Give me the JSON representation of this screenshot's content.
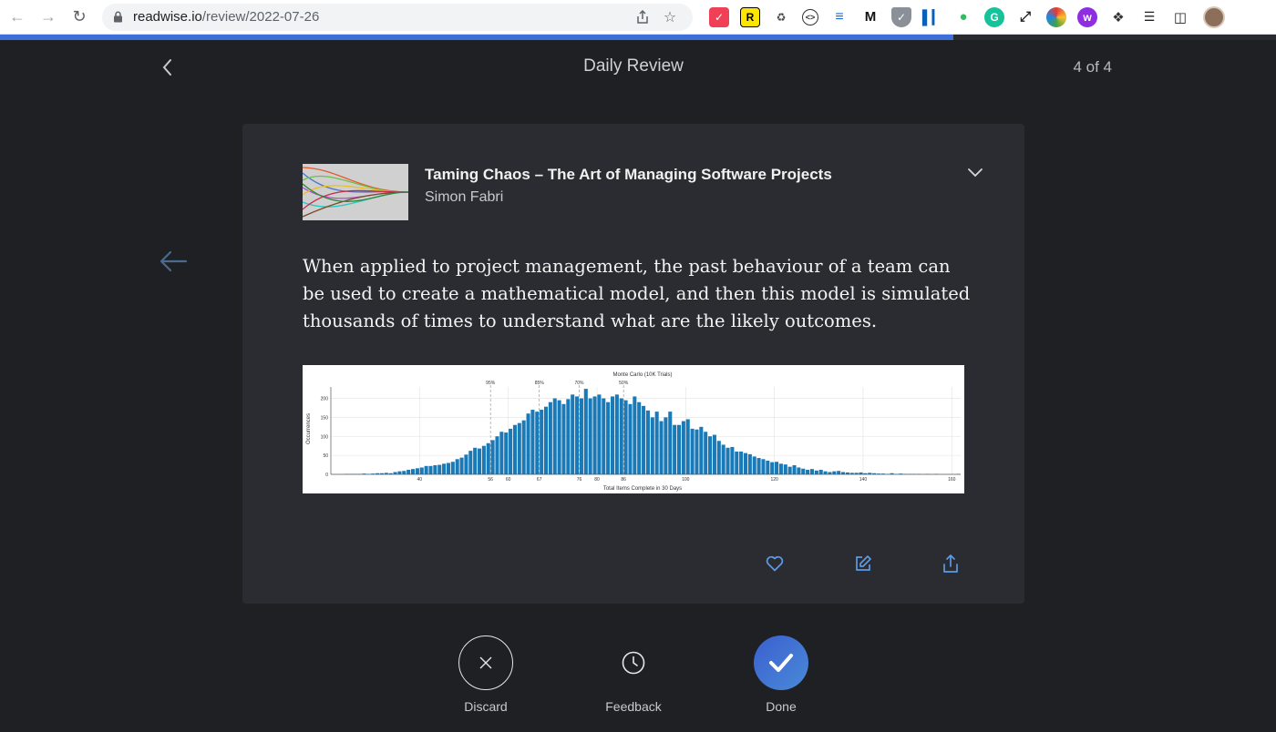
{
  "browser": {
    "url_host": "readwise.io",
    "url_path": "/review/2022-07-26"
  },
  "review": {
    "title": "Daily Review",
    "counter": "4 of 4",
    "progress": 0.747
  },
  "card": {
    "book_title": "Taming Chaos – The Art of Managing Software Projects",
    "author": "Simon Fabri",
    "highlight": "When applied to project management, the past behaviour of a team can be used to create a mathematical model, and then this model is simulated thousands of times to understand what are the likely outcomes."
  },
  "controls": {
    "discard_label": "Discard",
    "feedback_label": "Feedback",
    "done_label": "Done"
  },
  "colors": {
    "accent": "#3d6fd8",
    "icon_blue": "#5b9be6",
    "bar_blue": "#1a7ab8"
  },
  "chart_data": {
    "type": "bar",
    "title": "Monte Carlo (10K Trials)",
    "xlabel": "Total Items Complete in 30 Days",
    "ylabel": "Occurrences",
    "xlim": [
      20,
      162
    ],
    "ylim": [
      0,
      230
    ],
    "xticks": [
      40,
      56,
      60,
      67,
      76,
      80,
      86,
      100,
      120,
      140,
      160
    ],
    "yticks": [
      0,
      50,
      100,
      150,
      200
    ],
    "percentile_markers": [
      {
        "label": "95%",
        "x": 56
      },
      {
        "label": "85%",
        "x": 67
      },
      {
        "label": "70%",
        "x": 76
      },
      {
        "label": "50%",
        "x": 86
      }
    ],
    "bin_start": 20,
    "bin_width": 1,
    "values": [
      0,
      0,
      0,
      1,
      1,
      1,
      1,
      2,
      1,
      2,
      3,
      3,
      4,
      3,
      6,
      8,
      9,
      12,
      14,
      16,
      18,
      22,
      22,
      24,
      25,
      28,
      30,
      33,
      40,
      44,
      52,
      62,
      70,
      68,
      75,
      82,
      90,
      100,
      112,
      110,
      120,
      130,
      135,
      142,
      160,
      170,
      165,
      170,
      178,
      190,
      200,
      195,
      185,
      198,
      210,
      205,
      200,
      225,
      200,
      205,
      210,
      200,
      190,
      205,
      210,
      200,
      195,
      185,
      205,
      190,
      180,
      168,
      150,
      165,
      140,
      150,
      165,
      130,
      130,
      140,
      145,
      120,
      118,
      125,
      112,
      100,
      104,
      88,
      78,
      70,
      72,
      60,
      60,
      56,
      53,
      47,
      43,
      40,
      36,
      32,
      33,
      28,
      26,
      20,
      24,
      18,
      15,
      12,
      14,
      10,
      12,
      8,
      6,
      8,
      9,
      6,
      5,
      4,
      4,
      5,
      3,
      4,
      3,
      2,
      2,
      1,
      3,
      1,
      2,
      1,
      1,
      1,
      1,
      0,
      1,
      0,
      1,
      0,
      0,
      0,
      0,
      1
    ]
  }
}
